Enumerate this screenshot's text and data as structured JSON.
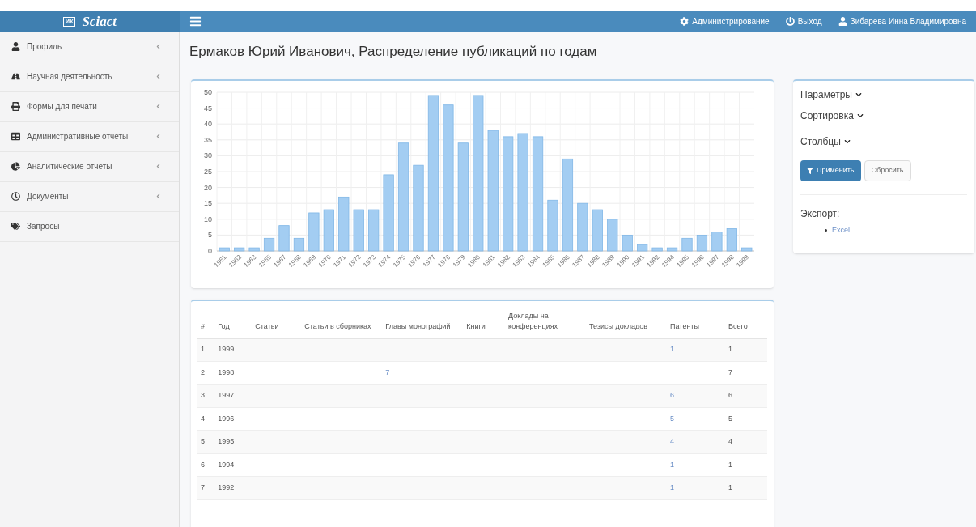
{
  "brand": {
    "name": "Sciact",
    "badge": "ИК"
  },
  "topbar": {
    "links": [
      {
        "kind": "gear",
        "label": "Администрирование"
      },
      {
        "kind": "power",
        "label": "Выход"
      },
      {
        "kind": "user",
        "label": "Зибарева Инна Владимировна"
      }
    ]
  },
  "sidebar": {
    "items": [
      {
        "kind": "user",
        "label": "Профиль",
        "expandable": true
      },
      {
        "kind": "road",
        "label": "Научная деятельность",
        "expandable": true
      },
      {
        "kind": "print",
        "label": "Формы для печати",
        "expandable": true
      },
      {
        "kind": "table",
        "label": "Административные отчеты",
        "expandable": true
      },
      {
        "kind": "chart",
        "label": "Аналитические отчеты",
        "expandable": true
      },
      {
        "kind": "clock",
        "label": "Документы",
        "expandable": true
      },
      {
        "kind": "tag",
        "label": "Запросы",
        "expandable": false
      }
    ]
  },
  "page_title": "Ермаков Юрий Иванович, Распределение публикаций по годам",
  "chart": {
    "chart_data": {
      "type": "bar",
      "categories": [
        "1961",
        "1962",
        "1963",
        "1965",
        "1967",
        "1968",
        "1969",
        "1970",
        "1971",
        "1972",
        "1973",
        "1974",
        "1975",
        "1976",
        "1977",
        "1978",
        "1979",
        "1980",
        "1981",
        "1982",
        "1983",
        "1984",
        "1985",
        "1986",
        "1987",
        "1988",
        "1989",
        "1990",
        "1991",
        "1992",
        "1994",
        "1995",
        "1996",
        "1997",
        "1998",
        "1999"
      ],
      "grid": true,
      "series": [
        {
          "color": "#a3cdf2",
          "values": [
            1,
            1,
            1,
            4,
            8,
            4,
            12,
            13,
            17,
            13,
            13,
            24,
            34,
            27,
            49,
            46,
            34,
            49,
            38,
            36,
            37,
            36,
            16,
            29,
            15,
            13,
            10,
            5,
            2,
            1,
            1,
            4,
            5,
            6,
            7,
            1
          ]
        }
      ],
      "ylim": [
        0,
        50
      ],
      "yticks": [
        0,
        5,
        10,
        15,
        20,
        25,
        30,
        35,
        40,
        45,
        50
      ]
    }
  },
  "filters": {
    "sections": [
      "Параметры",
      "Сортировка",
      "Столбцы"
    ],
    "apply_button": "Применить",
    "reset_button": "Сбросить",
    "export_title": "Экспорт:",
    "export_links": [
      "Excel"
    ]
  },
  "table": {
    "columns": [
      "#",
      "Год",
      "Статьи",
      "Статьи в сборниках",
      "Главы монографий",
      "Книги",
      "Доклады на конференциях",
      "Тезисы докладов",
      "Патенты",
      "Всего"
    ],
    "rows": [
      {
        "num": "1",
        "year": "1999",
        "patents": "1",
        "total": "1"
      },
      {
        "num": "2",
        "year": "1998",
        "chapters": "7",
        "total": "7"
      },
      {
        "num": "3",
        "year": "1997",
        "patents": "6",
        "total": "6"
      },
      {
        "num": "4",
        "year": "1996",
        "patents": "5",
        "total": "5"
      },
      {
        "num": "5",
        "year": "1995",
        "patents": "4",
        "total": "4"
      },
      {
        "num": "6",
        "year": "1994",
        "patents": "1",
        "total": "1"
      },
      {
        "num": "7",
        "year": "1992",
        "patents": "1",
        "total": "1"
      }
    ]
  }
}
